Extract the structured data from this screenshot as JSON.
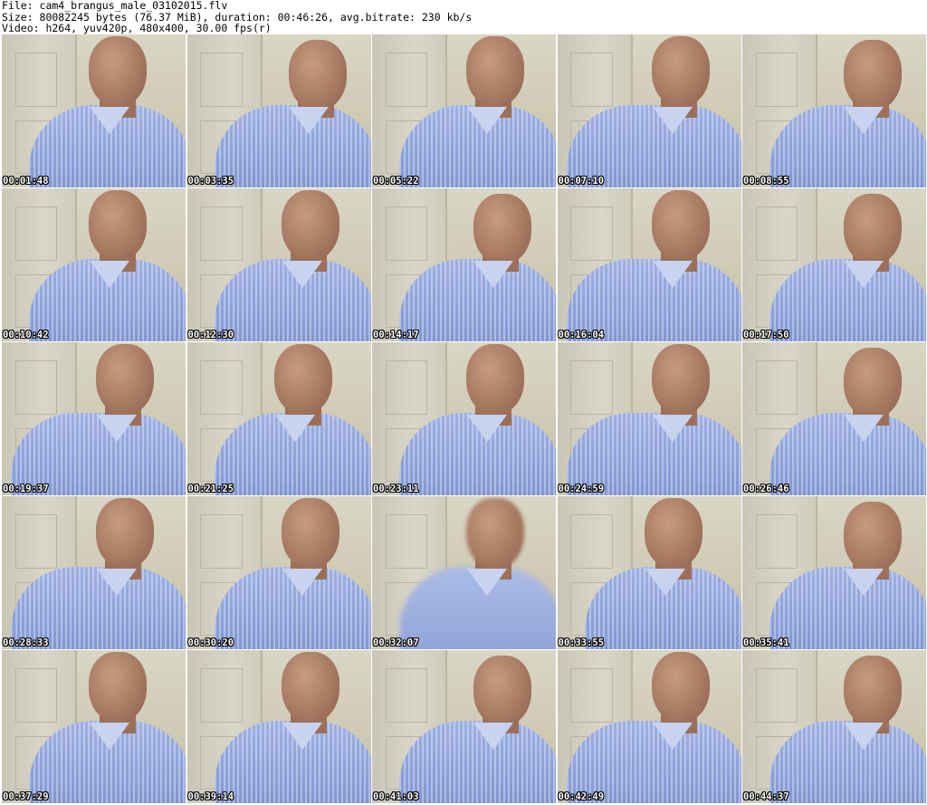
{
  "header": {
    "line1": "File: cam4_brangus_male_03102015.flv",
    "line2": "Size: 80082245 bytes (76.37 MiB), duration: 00:46:26, avg.bitrate: 230 kb/s",
    "line3": "Video: h264, yuv420p, 480x400, 30.00 fps(r)"
  },
  "frames": [
    {
      "time": "00:01:48"
    },
    {
      "time": "00:03:35"
    },
    {
      "time": "00:05:22"
    },
    {
      "time": "00:07:10"
    },
    {
      "time": "00:08:55"
    },
    {
      "time": "00:10:42"
    },
    {
      "time": "00:12:30"
    },
    {
      "time": "00:14:17"
    },
    {
      "time": "00:16:04"
    },
    {
      "time": "00:17:50"
    },
    {
      "time": "00:19:37"
    },
    {
      "time": "00:21:25"
    },
    {
      "time": "00:23:11"
    },
    {
      "time": "00:24:59"
    },
    {
      "time": "00:26:46"
    },
    {
      "time": "00:28:33"
    },
    {
      "time": "00:30:20"
    },
    {
      "time": "00:32:07"
    },
    {
      "time": "00:33:55"
    },
    {
      "time": "00:35:41"
    },
    {
      "time": "00:37:29"
    },
    {
      "time": "00:39:14"
    },
    {
      "time": "00:41:03"
    },
    {
      "time": "00:42:49"
    },
    {
      "time": "00:44:37"
    }
  ]
}
